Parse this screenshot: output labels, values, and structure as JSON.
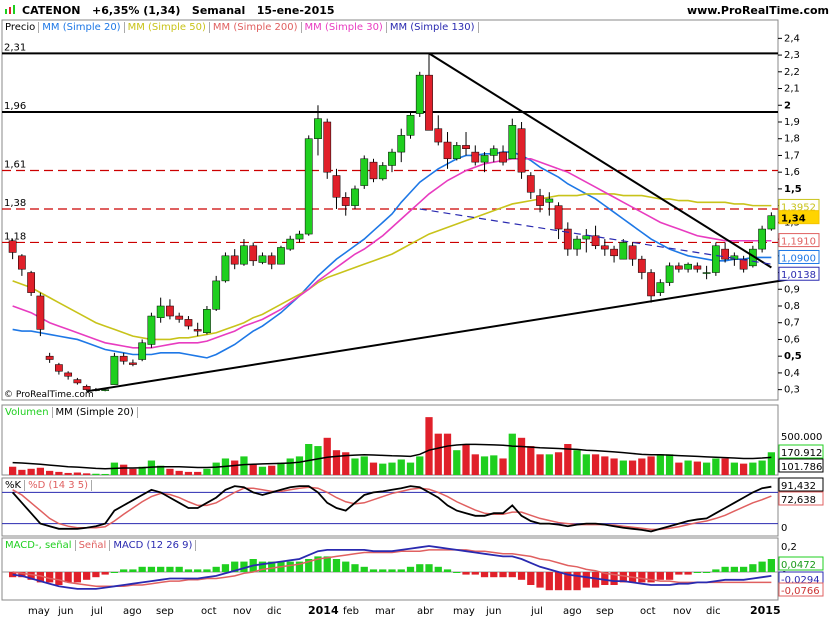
{
  "header": {
    "instrument": "CATENON",
    "change": "+6,35% (1,34)",
    "period": "Semanal",
    "date": "15-ene-2015",
    "site": "www.ProRealTime.com"
  },
  "price_legend": [
    "Precio",
    "MM (Simple 20)",
    "MM (Simple 50)",
    "MM (Simple 200)",
    "MM (Simple 30)",
    "MM (Simple 130)"
  ],
  "volume_legend": [
    "Volumen",
    "MM (Simple 20)"
  ],
  "stoch_legend": [
    "%K",
    "%D (14 3 5)"
  ],
  "macd_legend": [
    "MACD-, señal",
    "Señal",
    "MACD (12 26 9)"
  ],
  "copyright": "© ProRealTime.com",
  "colors": {
    "up": "#1fcf1f",
    "down": "#e0202a",
    "mm20": "#1e78e6",
    "mm50": "#c8c31a",
    "mm200": "#e06060",
    "mm30": "#e83cc0",
    "mm130": "#2a2ab0",
    "hline_black": "#000000",
    "hline_red": "#cc0000"
  },
  "level_labels": [
    "2,31",
    "1,96",
    "1,61",
    "1,38",
    "1,18"
  ],
  "x_labels": [
    "may",
    "jun",
    "jul",
    "ago",
    "sep",
    "oct",
    "nov",
    "dic",
    "2014",
    "feb",
    "mar",
    "abr",
    "may",
    "jun",
    "jul",
    "ago",
    "sep",
    "oct",
    "nov",
    "dic",
    "2015"
  ],
  "y_ticks": [
    "2,4",
    "2,3",
    "2,2",
    "2,1",
    "2",
    "1,9",
    "1,8",
    "1,7",
    "1,6",
    "1,5",
    "1,4",
    "1,3",
    "1,2",
    "1,1",
    "1",
    "0,9",
    "0,8",
    "0,7",
    "0,6",
    "0,5",
    "0,4",
    "0,3"
  ],
  "value_tags": [
    "1,3952",
    "1,34",
    "1,1910",
    "1,0900",
    "1,0138"
  ],
  "volume_ticks": [
    "500.000",
    "170.912",
    "101.786"
  ],
  "stoch_ticks": [
    "91,432",
    "72,638",
    "0"
  ],
  "macd_ticks": [
    "0,2",
    "0,0472",
    "0",
    "-0,0294",
    "-0,0766"
  ],
  "chart_data": {
    "type": "candlestick",
    "title": "CATENON +6,35% (1,34) Semanal 15-ene-2015",
    "ylim": [
      0.25,
      2.42
    ],
    "horizontal_levels": [
      {
        "value": 2.31,
        "style": "solid",
        "color": "black"
      },
      {
        "value": 1.96,
        "style": "solid",
        "color": "black"
      },
      {
        "value": 1.61,
        "style": "dashed",
        "color": "red"
      },
      {
        "value": 1.38,
        "style": "dashed",
        "color": "red"
      },
      {
        "value": 1.18,
        "style": "dashed",
        "color": "red"
      }
    ],
    "candles": [
      [
        1.19,
        1.2,
        1.08,
        1.12
      ],
      [
        1.1,
        1.11,
        0.98,
        1.02
      ],
      [
        1.0,
        1.01,
        0.86,
        0.88
      ],
      [
        0.86,
        0.88,
        0.62,
        0.66
      ],
      [
        0.5,
        0.52,
        0.46,
        0.48
      ],
      [
        0.45,
        0.46,
        0.39,
        0.41
      ],
      [
        0.4,
        0.41,
        0.36,
        0.38
      ],
      [
        0.36,
        0.37,
        0.33,
        0.34
      ],
      [
        0.32,
        0.33,
        0.29,
        0.3
      ],
      [
        0.3,
        0.31,
        0.29,
        0.3
      ],
      [
        0.3,
        0.31,
        0.29,
        0.3
      ],
      [
        0.33,
        0.52,
        0.33,
        0.5
      ],
      [
        0.5,
        0.52,
        0.45,
        0.47
      ],
      [
        0.46,
        0.48,
        0.44,
        0.45
      ],
      [
        0.48,
        0.6,
        0.47,
        0.58
      ],
      [
        0.57,
        0.76,
        0.55,
        0.74
      ],
      [
        0.73,
        0.85,
        0.7,
        0.8
      ],
      [
        0.8,
        0.84,
        0.72,
        0.74
      ],
      [
        0.74,
        0.76,
        0.7,
        0.72
      ],
      [
        0.72,
        0.74,
        0.66,
        0.68
      ],
      [
        0.66,
        0.7,
        0.62,
        0.65
      ],
      [
        0.64,
        0.8,
        0.63,
        0.78
      ],
      [
        0.78,
        0.98,
        0.77,
        0.95
      ],
      [
        0.95,
        1.12,
        0.94,
        1.1
      ],
      [
        1.1,
        1.14,
        1.02,
        1.05
      ],
      [
        1.05,
        1.2,
        1.04,
        1.16
      ],
      [
        1.16,
        1.18,
        1.04,
        1.07
      ],
      [
        1.06,
        1.12,
        1.05,
        1.1
      ],
      [
        1.1,
        1.12,
        1.02,
        1.05
      ],
      [
        1.05,
        1.16,
        1.05,
        1.15
      ],
      [
        1.14,
        1.22,
        1.13,
        1.2
      ],
      [
        1.2,
        1.25,
        1.18,
        1.23
      ],
      [
        1.23,
        1.82,
        1.22,
        1.8
      ],
      [
        1.8,
        2.0,
        1.7,
        1.92
      ],
      [
        1.9,
        1.92,
        1.56,
        1.6
      ],
      [
        1.58,
        1.62,
        1.38,
        1.45
      ],
      [
        1.45,
        1.48,
        1.34,
        1.4
      ],
      [
        1.4,
        1.52,
        1.38,
        1.5
      ],
      [
        1.52,
        1.7,
        1.5,
        1.68
      ],
      [
        1.66,
        1.68,
        1.54,
        1.56
      ],
      [
        1.56,
        1.66,
        1.55,
        1.64
      ],
      [
        1.64,
        1.74,
        1.6,
        1.72
      ],
      [
        1.72,
        1.86,
        1.66,
        1.82
      ],
      [
        1.82,
        1.96,
        1.8,
        1.94
      ],
      [
        1.95,
        2.2,
        1.93,
        2.18
      ],
      [
        2.18,
        2.31,
        2.08,
        1.85
      ],
      [
        1.86,
        1.94,
        1.76,
        1.78
      ],
      [
        1.78,
        1.84,
        1.62,
        1.68
      ],
      [
        1.68,
        1.78,
        1.67,
        1.76
      ],
      [
        1.76,
        1.84,
        1.7,
        1.74
      ],
      [
        1.72,
        1.76,
        1.64,
        1.66
      ],
      [
        1.66,
        1.72,
        1.6,
        1.7
      ],
      [
        1.7,
        1.76,
        1.66,
        1.74
      ],
      [
        1.72,
        1.76,
        1.64,
        1.66
      ],
      [
        1.68,
        1.92,
        1.68,
        1.88
      ],
      [
        1.86,
        1.9,
        1.56,
        1.6
      ],
      [
        1.58,
        1.6,
        1.44,
        1.48
      ],
      [
        1.46,
        1.5,
        1.36,
        1.4
      ],
      [
        1.42,
        1.48,
        1.34,
        1.44
      ],
      [
        1.4,
        1.42,
        1.2,
        1.26
      ],
      [
        1.26,
        1.3,
        1.1,
        1.14
      ],
      [
        1.14,
        1.22,
        1.1,
        1.2
      ],
      [
        1.2,
        1.26,
        1.12,
        1.22
      ],
      [
        1.22,
        1.28,
        1.14,
        1.16
      ],
      [
        1.16,
        1.2,
        1.1,
        1.14
      ],
      [
        1.14,
        1.16,
        1.06,
        1.1
      ],
      [
        1.08,
        1.2,
        1.08,
        1.18
      ],
      [
        1.16,
        1.18,
        1.04,
        1.08
      ],
      [
        1.08,
        1.1,
        0.96,
        1.0
      ],
      [
        1.0,
        1.02,
        0.82,
        0.86
      ],
      [
        0.88,
        0.96,
        0.86,
        0.94
      ],
      [
        0.94,
        1.06,
        0.92,
        1.04
      ],
      [
        1.04,
        1.06,
        1.0,
        1.02
      ],
      [
        1.02,
        1.06,
        1.0,
        1.05
      ],
      [
        1.04,
        1.06,
        1.0,
        1.02
      ],
      [
        1.0,
        1.04,
        0.96,
        1.0
      ],
      [
        1.0,
        1.18,
        0.98,
        1.16
      ],
      [
        1.14,
        1.18,
        1.06,
        1.08
      ],
      [
        1.08,
        1.12,
        1.04,
        1.1
      ],
      [
        1.08,
        1.1,
        1.0,
        1.02
      ],
      [
        1.04,
        1.16,
        1.03,
        1.14
      ],
      [
        1.14,
        1.28,
        1.12,
        1.26
      ],
      [
        1.26,
        1.36,
        1.25,
        1.34
      ]
    ],
    "moving_averages": {
      "MM (Simple 20)": [
        0.66,
        0.65,
        0.65,
        0.64,
        0.63,
        0.62,
        0.61,
        0.6,
        0.58,
        0.56,
        0.54,
        0.53,
        0.52,
        0.51,
        0.51,
        0.51,
        0.52,
        0.52,
        0.52,
        0.51,
        0.5,
        0.49,
        0.51,
        0.54,
        0.57,
        0.61,
        0.65,
        0.68,
        0.72,
        0.76,
        0.81,
        0.86,
        0.92,
        0.98,
        1.03,
        1.08,
        1.12,
        1.16,
        1.2,
        1.25,
        1.3,
        1.35,
        1.42,
        1.48,
        1.54,
        1.58,
        1.62,
        1.65,
        1.68,
        1.7,
        1.7,
        1.71,
        1.71,
        1.72,
        1.72,
        1.7,
        1.67,
        1.63,
        1.6,
        1.57,
        1.53,
        1.5,
        1.47,
        1.44,
        1.4,
        1.36,
        1.32,
        1.28,
        1.24,
        1.2,
        1.17,
        1.14,
        1.12,
        1.1,
        1.09,
        1.08,
        1.07,
        1.07,
        1.08,
        1.08,
        1.09,
        1.09,
        1.09
      ],
      "MM (Simple 50)": [
        0.95,
        0.93,
        0.91,
        0.88,
        0.85,
        0.82,
        0.79,
        0.76,
        0.73,
        0.7,
        0.68,
        0.66,
        0.64,
        0.62,
        0.61,
        0.6,
        0.6,
        0.6,
        0.61,
        0.61,
        0.62,
        0.63,
        0.64,
        0.66,
        0.68,
        0.7,
        0.73,
        0.75,
        0.78,
        0.81,
        0.84,
        0.87,
        0.9,
        0.94,
        0.97,
        0.99,
        1.01,
        1.03,
        1.05,
        1.07,
        1.09,
        1.11,
        1.14,
        1.17,
        1.2,
        1.23,
        1.25,
        1.27,
        1.29,
        1.31,
        1.33,
        1.35,
        1.37,
        1.39,
        1.41,
        1.42,
        1.43,
        1.44,
        1.45,
        1.46,
        1.46,
        1.46,
        1.47,
        1.47,
        1.47,
        1.47,
        1.46,
        1.46,
        1.46,
        1.45,
        1.44,
        1.44,
        1.43,
        1.43,
        1.42,
        1.42,
        1.42,
        1.42,
        1.41,
        1.41,
        1.4,
        1.4,
        1.4
      ],
      "MM (Simple 30)": [
        0.8,
        0.78,
        0.76,
        0.73,
        0.7,
        0.68,
        0.66,
        0.64,
        0.62,
        0.6,
        0.58,
        0.57,
        0.56,
        0.55,
        0.55,
        0.55,
        0.56,
        0.57,
        0.58,
        0.58,
        0.58,
        0.59,
        0.61,
        0.63,
        0.65,
        0.68,
        0.7,
        0.72,
        0.75,
        0.78,
        0.82,
        0.86,
        0.9,
        0.95,
        0.99,
        1.03,
        1.07,
        1.11,
        1.14,
        1.18,
        1.22,
        1.27,
        1.32,
        1.37,
        1.42,
        1.47,
        1.51,
        1.55,
        1.58,
        1.61,
        1.63,
        1.65,
        1.66,
        1.67,
        1.68,
        1.68,
        1.68,
        1.66,
        1.64,
        1.62,
        1.6,
        1.57,
        1.54,
        1.51,
        1.48,
        1.45,
        1.42,
        1.39,
        1.36,
        1.33,
        1.3,
        1.28,
        1.26,
        1.24,
        1.22,
        1.21,
        1.2,
        1.19,
        1.19,
        1.19,
        1.19,
        1.19,
        1.19
      ]
    },
    "trendlines": [
      {
        "from": [
          45,
          2.31
        ],
        "to": [
          82,
          1.03
        ]
      },
      {
        "from": [
          8,
          0.29
        ],
        "to": [
          84,
          0.96
        ]
      },
      {
        "from": [
          44,
          1.38
        ],
        "to": [
          82,
          1.05
        ],
        "style": "dashed"
      }
    ],
    "volume": [
      40,
      25,
      30,
      35,
      20,
      15,
      10,
      12,
      8,
      6,
      5,
      60,
      50,
      30,
      40,
      70,
      45,
      30,
      20,
      15,
      15,
      30,
      60,
      80,
      70,
      90,
      50,
      40,
      45,
      60,
      80,
      90,
      150,
      140,
      180,
      120,
      110,
      80,
      90,
      60,
      55,
      60,
      75,
      60,
      90,
      280,
      200,
      200,
      120,
      150,
      100,
      90,
      95,
      80,
      200,
      180,
      140,
      100,
      100,
      110,
      150,
      120,
      100,
      100,
      90,
      80,
      70,
      70,
      80,
      90,
      100,
      100,
      60,
      70,
      65,
      60,
      80,
      80,
      60,
      55,
      60,
      70,
      110
    ],
    "volume_ma": [
      60,
      58,
      55,
      52,
      48,
      44,
      40,
      38,
      35,
      32,
      30,
      32,
      34,
      34,
      35,
      38,
      40,
      40,
      40,
      38,
      36,
      36,
      38,
      42,
      46,
      50,
      52,
      54,
      55,
      56,
      58,
      62,
      70,
      78,
      86,
      90,
      94,
      96,
      98,
      97,
      95,
      93,
      92,
      90,
      100,
      120,
      130,
      140,
      145,
      148,
      148,
      147,
      146,
      144,
      140,
      138,
      135,
      132,
      130,
      128,
      126,
      124,
      120,
      118,
      115,
      112,
      108,
      104,
      100,
      98,
      98,
      96,
      94,
      92,
      90,
      88,
      86,
      84,
      82,
      80,
      80,
      82,
      85
    ],
    "stochastic": {
      "%K": [
        80,
        60,
        40,
        20,
        15,
        10,
        10,
        10,
        12,
        15,
        20,
        45,
        55,
        65,
        75,
        85,
        80,
        70,
        60,
        50,
        50,
        60,
        70,
        85,
        92,
        90,
        80,
        75,
        80,
        85,
        90,
        92,
        92,
        80,
        60,
        50,
        45,
        60,
        75,
        80,
        82,
        85,
        88,
        92,
        90,
        80,
        70,
        55,
        45,
        40,
        35,
        35,
        40,
        40,
        55,
        35,
        25,
        20,
        20,
        18,
        15,
        18,
        20,
        20,
        18,
        15,
        12,
        10,
        8,
        5,
        10,
        15,
        20,
        25,
        28,
        30,
        40,
        50,
        60,
        70,
        80,
        88,
        91
      ],
      "%D": [
        85,
        75,
        60,
        45,
        30,
        20,
        15,
        12,
        12,
        12,
        14,
        25,
        38,
        50,
        62,
        72,
        78,
        76,
        70,
        62,
        55,
        55,
        60,
        70,
        80,
        88,
        88,
        85,
        82,
        82,
        85,
        88,
        90,
        88,
        80,
        70,
        62,
        58,
        60,
        66,
        72,
        78,
        82,
        86,
        88,
        86,
        80,
        72,
        62,
        54,
        46,
        40,
        38,
        38,
        42,
        42,
        36,
        30,
        26,
        22,
        20,
        18,
        18,
        18,
        18,
        17,
        15,
        13,
        11,
        9,
        9,
        11,
        14,
        18,
        22,
        25,
        30,
        36,
        44,
        52,
        60,
        66,
        73
      ]
    },
    "macd": {
      "MACD": [
        -0.02,
        -0.03,
        -0.05,
        -0.07,
        -0.09,
        -0.11,
        -0.12,
        -0.13,
        -0.13,
        -0.13,
        -0.12,
        -0.11,
        -0.1,
        -0.09,
        -0.08,
        -0.07,
        -0.06,
        -0.05,
        -0.05,
        -0.05,
        -0.05,
        -0.04,
        -0.03,
        -0.01,
        0.01,
        0.03,
        0.05,
        0.06,
        0.07,
        0.08,
        0.09,
        0.1,
        0.13,
        0.16,
        0.17,
        0.17,
        0.17,
        0.17,
        0.17,
        0.16,
        0.16,
        0.16,
        0.17,
        0.18,
        0.19,
        0.2,
        0.19,
        0.18,
        0.17,
        0.16,
        0.15,
        0.14,
        0.13,
        0.12,
        0.12,
        0.1,
        0.07,
        0.04,
        0.02,
        0.0,
        -0.02,
        -0.03,
        -0.04,
        -0.05,
        -0.06,
        -0.07,
        -0.07,
        -0.08,
        -0.09,
        -0.1,
        -0.1,
        -0.1,
        -0.09,
        -0.09,
        -0.08,
        -0.08,
        -0.07,
        -0.06,
        -0.06,
        -0.06,
        -0.05,
        -0.04,
        -0.03
      ],
      "Señal": [
        0.0,
        -0.01,
        -0.02,
        -0.03,
        -0.05,
        -0.06,
        -0.08,
        -0.09,
        -0.1,
        -0.11,
        -0.11,
        -0.11,
        -0.11,
        -0.1,
        -0.1,
        -0.09,
        -0.08,
        -0.07,
        -0.07,
        -0.06,
        -0.06,
        -0.05,
        -0.05,
        -0.04,
        -0.03,
        -0.01,
        0.0,
        0.02,
        0.03,
        0.04,
        0.05,
        0.06,
        0.08,
        0.1,
        0.11,
        0.12,
        0.13,
        0.14,
        0.15,
        0.15,
        0.15,
        0.15,
        0.16,
        0.16,
        0.16,
        0.17,
        0.17,
        0.17,
        0.17,
        0.17,
        0.16,
        0.16,
        0.15,
        0.14,
        0.14,
        0.13,
        0.12,
        0.1,
        0.09,
        0.07,
        0.05,
        0.04,
        0.02,
        0.01,
        -0.01,
        -0.02,
        -0.03,
        -0.04,
        -0.05,
        -0.06,
        -0.07,
        -0.07,
        -0.08,
        -0.08,
        -0.08,
        -0.08,
        -0.08,
        -0.08,
        -0.08,
        -0.08,
        -0.08,
        -0.08,
        -0.08
      ]
    }
  }
}
